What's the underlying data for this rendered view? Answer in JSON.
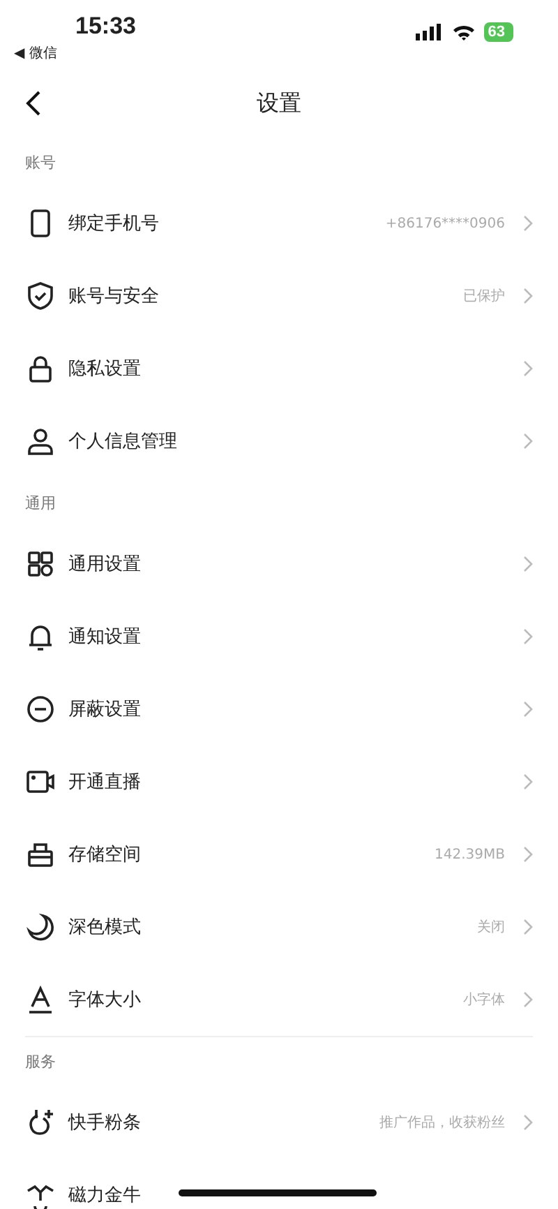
{
  "status_bar": {
    "time": "15:33",
    "back_app": "◀ 微信",
    "battery": "63"
  },
  "nav": {
    "title": "设置"
  },
  "sections": [
    {
      "header": "账号",
      "items": [
        {
          "label": "绑定手机号",
          "value": "+86176****0906"
        },
        {
          "label": "账号与安全",
          "value": "已保护"
        },
        {
          "label": "隐私设置"
        },
        {
          "label": "个人信息管理"
        }
      ]
    },
    {
      "header": "通用",
      "items": [
        {
          "label": "通用设置"
        },
        {
          "label": "通知设置"
        },
        {
          "label": "屏蔽设置"
        },
        {
          "label": "开通直播"
        },
        {
          "label": "存储空间",
          "value": "142.39MB"
        },
        {
          "label": "深色模式",
          "value": "关闭"
        },
        {
          "label": "字体大小",
          "value": "小字体"
        }
      ]
    },
    {
      "header": "服务",
      "items": [
        {
          "label": "快手粉条",
          "value": "推广作品，收获粉丝"
        },
        {
          "label": "磁力金牛",
          "chevron": false
        }
      ]
    }
  ]
}
